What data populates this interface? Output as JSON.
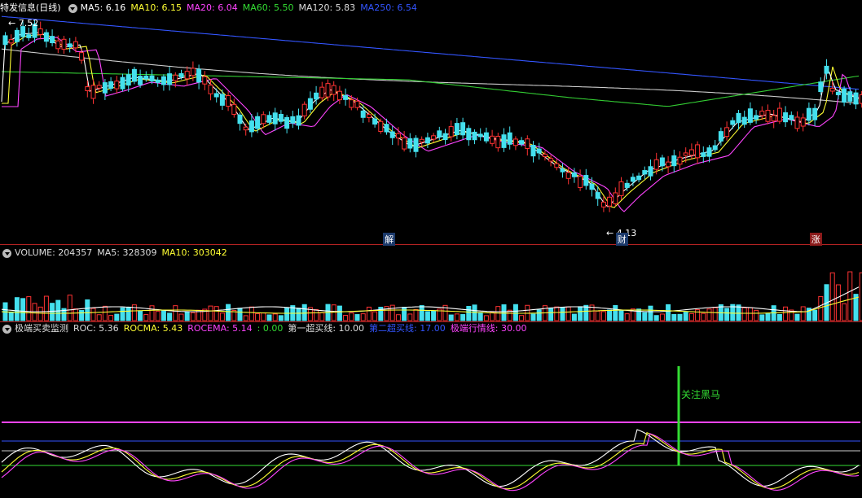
{
  "main_header": {
    "title": "特发信息(日线)",
    "ma": [
      {
        "label": "MA5: 6.16",
        "color": "#ffffff"
      },
      {
        "label": "MA10: 6.15",
        "color": "#ffff33"
      },
      {
        "label": "MA20: 6.04",
        "color": "#ff44ff"
      },
      {
        "label": "MA60: 5.50",
        "color": "#33dd33"
      },
      {
        "label": "MA120: 5.83",
        "color": "#dddddd"
      },
      {
        "label": "MA250: 6.54",
        "color": "#3355ff"
      }
    ]
  },
  "price_annotations": {
    "high": "7.52",
    "low": "4.13"
  },
  "event_markers": [
    {
      "label": "解",
      "at": 0.45
    },
    {
      "label": "财",
      "at": 0.72
    },
    {
      "label": "涨",
      "at": 0.945
    }
  ],
  "volume_header": {
    "items": [
      {
        "label": "VOLUME: 204357",
        "color": "#dddddd"
      },
      {
        "label": "MA5: 328309",
        "color": "#dddddd"
      },
      {
        "label": "MA10: 303042",
        "color": "#ffff33"
      }
    ]
  },
  "indicator_header": {
    "title": "极端买卖监测",
    "items": [
      {
        "label": "ROC: 5.36",
        "color": "#dddddd"
      },
      {
        "label": "ROCMA: 5.43",
        "color": "#ffff33"
      },
      {
        "label": "ROCEMA: 5.14",
        "color": "#ff44ff"
      },
      {
        "label": ": 0.00",
        "color": "#33dd33"
      },
      {
        "label": "第一超买线: 10.00",
        "color": "#dddddd"
      },
      {
        "label": "第二超买线: 17.00",
        "color": "#3355ff"
      },
      {
        "label": "极端行情线: 30.00",
        "color": "#ff44ff"
      }
    ]
  },
  "signal": {
    "label": "关注黑马",
    "color": "#33dd33"
  },
  "colors": {
    "up": "#ff3333",
    "down": "#44e0ee",
    "separator": "#b22222"
  }
}
